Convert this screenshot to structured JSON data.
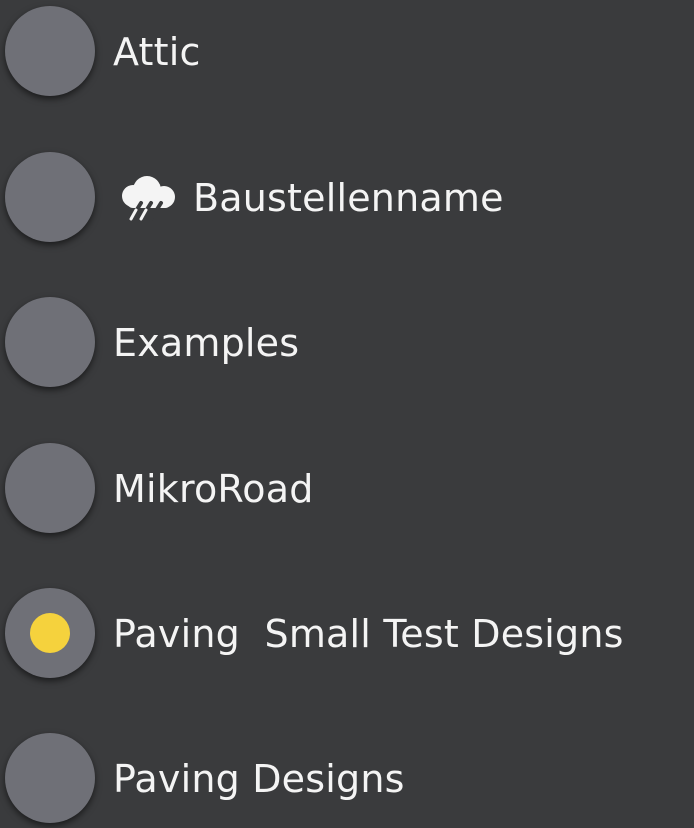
{
  "options": [
    {
      "label": "Attic",
      "selected": false,
      "icon": null
    },
    {
      "label": "Baustellenname",
      "selected": false,
      "icon": "cloud-rain-icon"
    },
    {
      "label": "Examples",
      "selected": false,
      "icon": null
    },
    {
      "label": "MikroRoad",
      "selected": false,
      "icon": null
    },
    {
      "label": "Paving  Small Test Designs",
      "selected": true,
      "icon": null
    },
    {
      "label": "Paving Designs",
      "selected": false,
      "icon": null
    }
  ],
  "colors": {
    "background": "#3a3b3d",
    "radio": "#6f7077",
    "selected_dot": "#f5d23d",
    "text": "#f4f4f4"
  }
}
